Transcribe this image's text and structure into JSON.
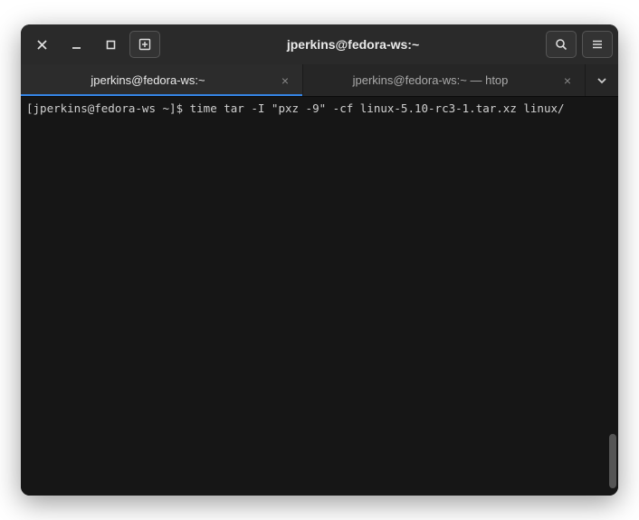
{
  "window": {
    "title": "jperkins@fedora-ws:~"
  },
  "tabs": [
    {
      "label": "jperkins@fedora-ws:~",
      "active": true
    },
    {
      "label": "jperkins@fedora-ws:~ — htop",
      "active": false
    }
  ],
  "terminal": {
    "prompt": "[jperkins@fedora-ws ~]$ ",
    "command": "time tar -I \"pxz -9\" -cf linux-5.10-rc3-1.tar.xz linux/"
  }
}
